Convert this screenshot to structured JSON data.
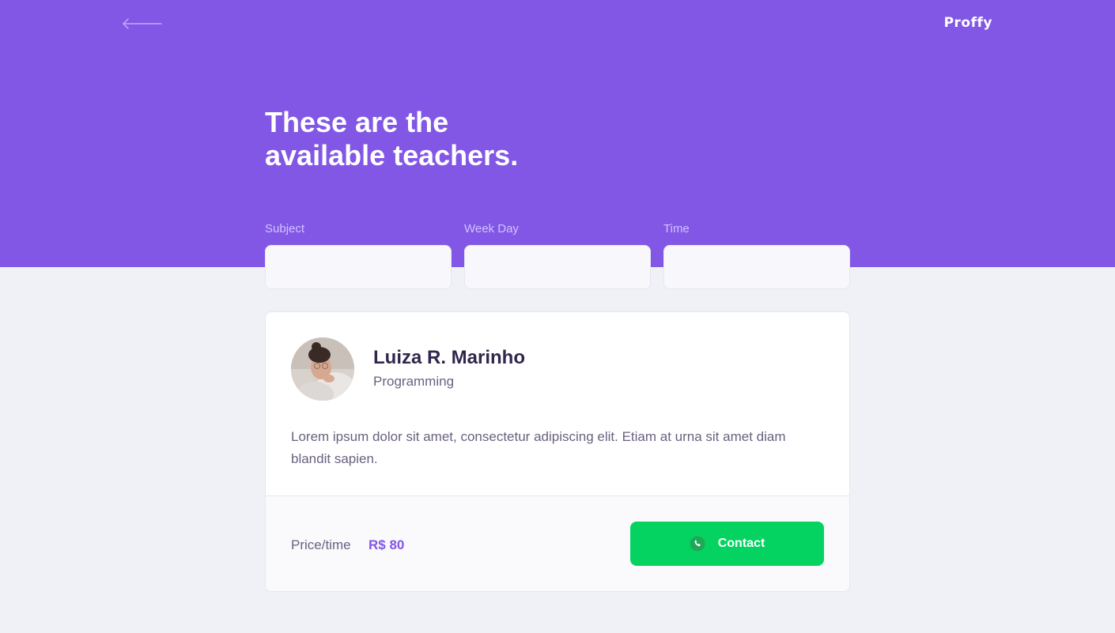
{
  "app": {
    "logo": "Proffy",
    "back_icon": "arrow-left-icon"
  },
  "header": {
    "title_line1": "These are the",
    "title_line2": "available teachers."
  },
  "filters": [
    {
      "label": "Subject",
      "value": ""
    },
    {
      "label": "Week Day",
      "value": ""
    },
    {
      "label": "Time",
      "value": ""
    }
  ],
  "teacher": {
    "name": "Luiza R. Marinho",
    "subject": "Programming",
    "bio": "Lorem ipsum dolor sit amet, consectetur adipiscing elit. Etiam at urna sit amet diam blandit sapien.",
    "price_label": "Price/time",
    "price_value": "R$ 80",
    "contact_label": "Contact",
    "contact_icon": "whatsapp-icon"
  },
  "colors": {
    "primary": "#8257E5",
    "background": "#F0F0F7",
    "title_text": "#32264D",
    "body_text": "#6A6180",
    "label_text": "#D4C2FF",
    "secondary_green": "#04D361"
  }
}
